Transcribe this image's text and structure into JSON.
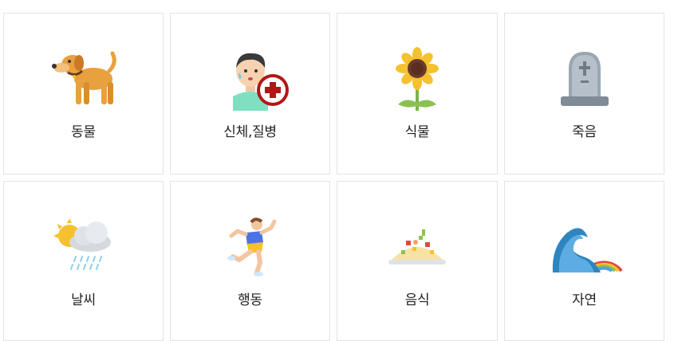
{
  "categories": [
    {
      "label": "동물",
      "icon": "dog-icon"
    },
    {
      "label": "신체,질병",
      "icon": "sick-person-icon"
    },
    {
      "label": "식물",
      "icon": "sunflower-icon"
    },
    {
      "label": "죽음",
      "icon": "tombstone-icon"
    },
    {
      "label": "날씨",
      "icon": "weather-icon"
    },
    {
      "label": "행동",
      "icon": "running-person-icon"
    },
    {
      "label": "음식",
      "icon": "food-dish-icon"
    },
    {
      "label": "자연",
      "icon": "wave-rainbow-icon"
    }
  ]
}
